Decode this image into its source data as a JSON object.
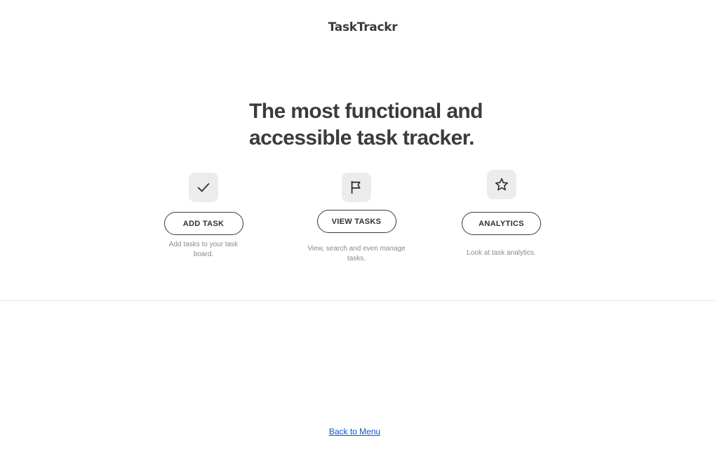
{
  "header": {
    "brand": "TaskTrackr"
  },
  "hero": {
    "headline_line1": "The most functional and",
    "headline_line2": "accessible task tracker."
  },
  "features": [
    {
      "icon": "checkmark-icon",
      "button_label": "ADD TASK",
      "description": "Add tasks to your task board."
    },
    {
      "icon": "flag-icon",
      "button_label": "VIEW TASKS",
      "description": "View, search and even manage tasks."
    },
    {
      "icon": "star-icon",
      "button_label": "ANALYTICS",
      "description": "Look at task analytics."
    }
  ],
  "footer": {
    "back_link": "Back to Menu"
  },
  "colors": {
    "text": "#3b3b3b",
    "muted": "#8a8a8a",
    "icon_bg": "#ececec",
    "link": "#0b57d0"
  }
}
